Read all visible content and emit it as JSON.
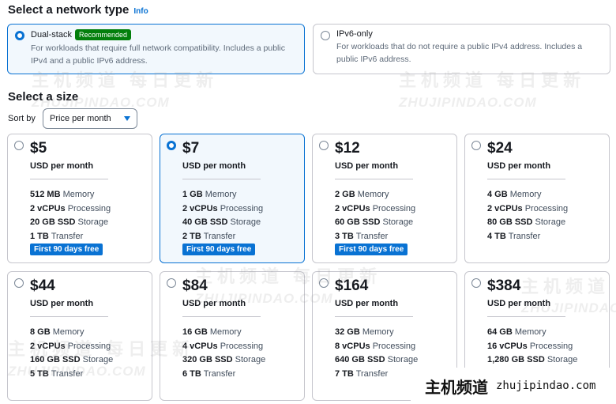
{
  "network": {
    "title": "Select a network type",
    "info_link": "Info",
    "options": [
      {
        "label": "Dual-stack",
        "badge": "Recommended",
        "description": "For workloads that require full network compatibility. Includes a public IPv4 and a public IPv6 address.",
        "selected": true
      },
      {
        "label": "IPv6-only",
        "description": "For workloads that do not require a public IPv4 address. Includes a public IPv6 address.",
        "selected": false
      }
    ]
  },
  "size": {
    "title": "Select a size",
    "sort_label": "Sort by",
    "sort_value": "Price per month",
    "plans": [
      {
        "price": "$5",
        "period": "USD per month",
        "memory": "512 MB",
        "memory_label": "Memory",
        "cpus": "2 vCPUs",
        "cpus_label": "Processing",
        "storage": "20 GB SSD",
        "storage_label": "Storage",
        "transfer": "1 TB",
        "transfer_label": "Transfer",
        "promo": "First 90 days free",
        "selected": false
      },
      {
        "price": "$7",
        "period": "USD per month",
        "memory": "1 GB",
        "memory_label": "Memory",
        "cpus": "2 vCPUs",
        "cpus_label": "Processing",
        "storage": "40 GB SSD",
        "storage_label": "Storage",
        "transfer": "2 TB",
        "transfer_label": "Transfer",
        "promo": "First 90 days free",
        "selected": true
      },
      {
        "price": "$12",
        "period": "USD per month",
        "memory": "2 GB",
        "memory_label": "Memory",
        "cpus": "2 vCPUs",
        "cpus_label": "Processing",
        "storage": "60 GB SSD",
        "storage_label": "Storage",
        "transfer": "3 TB",
        "transfer_label": "Transfer",
        "promo": "First 90 days free",
        "selected": false
      },
      {
        "price": "$24",
        "period": "USD per month",
        "memory": "4 GB",
        "memory_label": "Memory",
        "cpus": "2 vCPUs",
        "cpus_label": "Processing",
        "storage": "80 GB SSD",
        "storage_label": "Storage",
        "transfer": "4 TB",
        "transfer_label": "Transfer",
        "selected": false
      },
      {
        "price": "$44",
        "period": "USD per month",
        "memory": "8 GB",
        "memory_label": "Memory",
        "cpus": "2 vCPUs",
        "cpus_label": "Processing",
        "storage": "160 GB SSD",
        "storage_label": "Storage",
        "transfer": "5 TB",
        "transfer_label": "Transfer",
        "selected": false
      },
      {
        "price": "$84",
        "period": "USD per month",
        "memory": "16 GB",
        "memory_label": "Memory",
        "cpus": "4 vCPUs",
        "cpus_label": "Processing",
        "storage": "320 GB SSD",
        "storage_label": "Storage",
        "transfer": "6 TB",
        "transfer_label": "Transfer",
        "selected": false
      },
      {
        "price": "$164",
        "period": "USD per month",
        "memory": "32 GB",
        "memory_label": "Memory",
        "cpus": "8 vCPUs",
        "cpus_label": "Processing",
        "storage": "640 GB SSD",
        "storage_label": "Storage",
        "transfer": "7 TB",
        "transfer_label": "Transfer",
        "selected": false
      },
      {
        "price": "$384",
        "period": "USD per month",
        "memory": "64 GB",
        "memory_label": "Memory",
        "cpus": "16 vCPUs",
        "cpus_label": "Processing",
        "storage": "1,280 GB SSD",
        "storage_label": "Storage",
        "selected": false
      }
    ]
  },
  "watermark": {
    "zh": "主机频道 每日更新",
    "en": "ZHUJIPINDAO.COM",
    "brand_zh": "主机频道",
    "brand_en": "zhujipindao.com"
  },
  "colors": {
    "accent": "#0972d3",
    "recommended": "#037f0c",
    "selected_bg": "#f2f8fd"
  }
}
